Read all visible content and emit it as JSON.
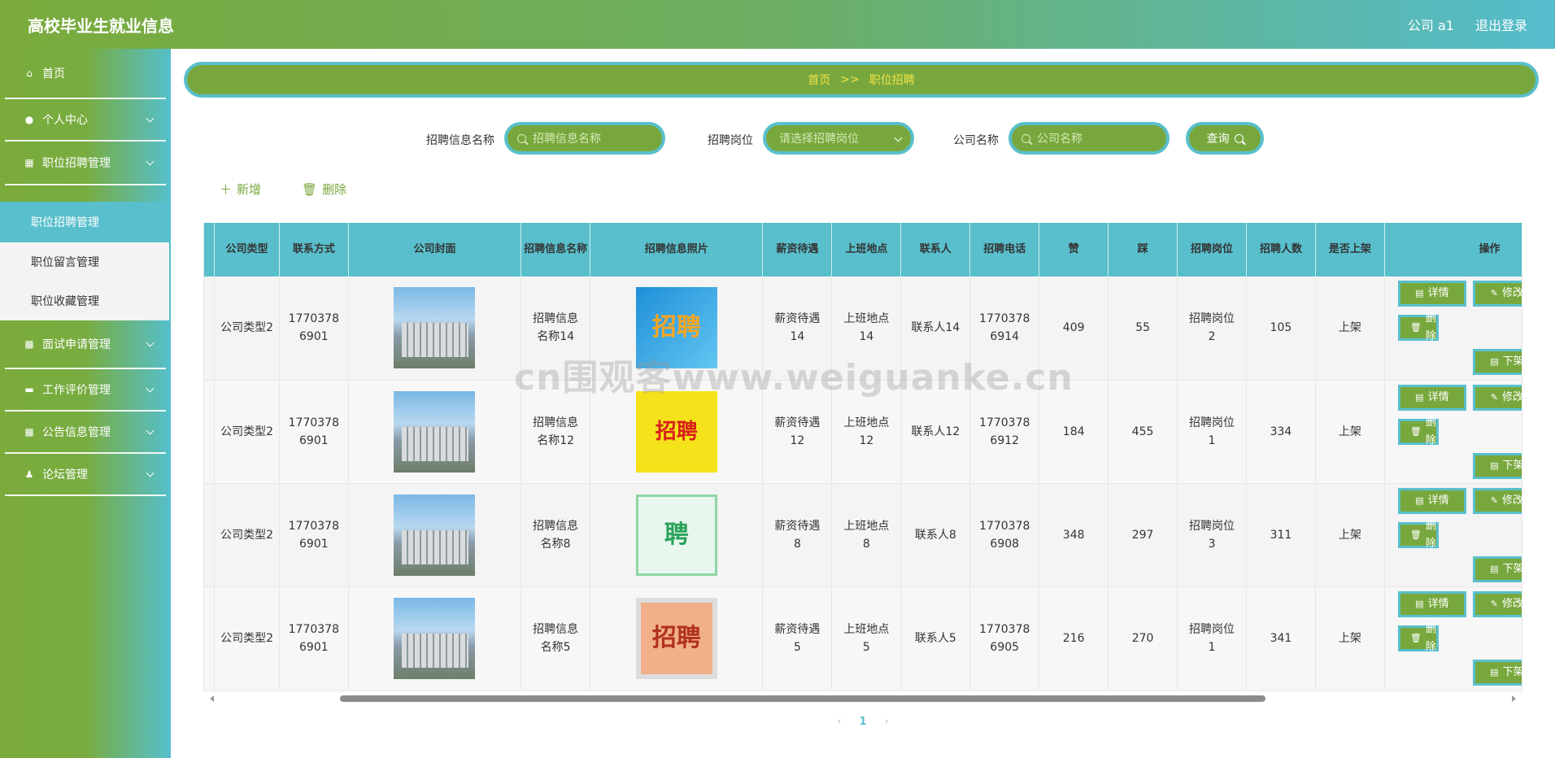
{
  "app": {
    "title": "高校毕业生就业信息",
    "user": "公司 a1",
    "logout": "退出登录"
  },
  "sidebar": {
    "items": [
      {
        "label": "首页",
        "icon": "home-icon"
      },
      {
        "label": "个人中心",
        "icon": "user-icon"
      },
      {
        "label": "职位招聘管理",
        "icon": "chart-icon"
      },
      {
        "label": "面试申请管理",
        "icon": "grid-icon"
      },
      {
        "label": "工作评价管理",
        "icon": "chat-icon"
      },
      {
        "label": "公告信息管理",
        "icon": "grid-icon"
      },
      {
        "label": "论坛管理",
        "icon": "person-icon"
      }
    ],
    "submenu": [
      "职位招聘管理",
      "职位留言管理",
      "职位收藏管理"
    ]
  },
  "breadcrumb": {
    "home": "首页",
    "sep": ">>",
    "current": "职位招聘"
  },
  "search": {
    "name_label": "招聘信息名称",
    "name_placeholder": "招聘信息名称",
    "post_label": "招聘岗位",
    "post_placeholder": "请选择招聘岗位",
    "company_label": "公司名称",
    "company_placeholder": "公司名称",
    "query": "查询"
  },
  "actions": {
    "add": "新增",
    "delete": "删除"
  },
  "table": {
    "headers": [
      "公司类型",
      "联系方式",
      "公司封面",
      "招聘信息名称",
      "招聘信息照片",
      "薪资待遇",
      "上班地点",
      "联系人",
      "招聘电话",
      "赞",
      "踩",
      "招聘岗位",
      "招聘人数",
      "是否上架",
      "操作"
    ],
    "rows": [
      {
        "type": "公司类型2",
        "contact": "17703786901",
        "name": "招聘信息名称14",
        "photo": "招聘",
        "salary": "薪资待遇14",
        "place": "上班地点14",
        "person": "联系人14",
        "phone": "17703786914",
        "up": "409",
        "down": "55",
        "post": "招聘岗位2",
        "count": "105",
        "shelf": "上架"
      },
      {
        "type": "公司类型2",
        "contact": "17703786901",
        "name": "招聘信息名称12",
        "photo": "招聘",
        "salary": "薪资待遇12",
        "place": "上班地点12",
        "person": "联系人12",
        "phone": "17703786912",
        "up": "184",
        "down": "455",
        "post": "招聘岗位1",
        "count": "334",
        "shelf": "上架"
      },
      {
        "type": "公司类型2",
        "contact": "17703786901",
        "name": "招聘信息名称8",
        "photo": "聘",
        "salary": "薪资待遇8",
        "place": "上班地点8",
        "person": "联系人8",
        "phone": "17703786908",
        "up": "348",
        "down": "297",
        "post": "招聘岗位3",
        "count": "311",
        "shelf": "上架"
      },
      {
        "type": "公司类型2",
        "contact": "17703786901",
        "name": "招聘信息名称5",
        "photo": "招聘",
        "salary": "薪资待遇5",
        "place": "上班地点5",
        "person": "联系人5",
        "phone": "17703786905",
        "up": "216",
        "down": "270",
        "post": "招聘岗位1",
        "count": "341",
        "shelf": "上架"
      }
    ],
    "ops": {
      "detail": "详情",
      "edit": "修改",
      "remove": "删除",
      "unshelf": "下架"
    }
  },
  "pager": {
    "prev": "‹",
    "page": "1",
    "next": "›"
  },
  "watermark": "cn围观客www.weiguanke.cn",
  "colors": {
    "green": "#78a83d",
    "teal": "#59bfcc",
    "breadcrumb_text": "#f2e24a"
  }
}
